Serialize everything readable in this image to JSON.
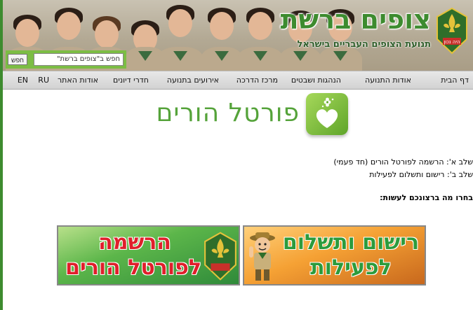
{
  "header": {
    "site_title": "צופים ברשת",
    "site_subtitle": "תנועת הצופים העבריים בישראל",
    "emblem_motto": "היה נכון"
  },
  "search": {
    "button_label": "חפש",
    "value": "חפש ב\"צופים ברשת\""
  },
  "nav": {
    "items": [
      {
        "label": "דף הבית"
      },
      {
        "label": "אודות התנועה"
      },
      {
        "label": "הנהגות ושבטים"
      },
      {
        "label": "מרכז הדרכה"
      },
      {
        "label": "אירועים בתנועה"
      },
      {
        "label": "חדרי דיונים"
      },
      {
        "label": "אודות האתר"
      },
      {
        "label": "RU"
      },
      {
        "label": "EN"
      }
    ]
  },
  "portal": {
    "title": "פורטל הורים"
  },
  "steps": {
    "step_a": "שלב א': הרשמה לפורטל הורים (חד פעמי)",
    "step_b": "שלב ב': רישום ותשלום לפעילות",
    "prompt": "בחרו מה ברצונכם לעשות:"
  },
  "banners": {
    "register": {
      "line1": "הרשמה",
      "line2": "לפורטל הורים"
    },
    "payment": {
      "line1": "רישום ותשלום",
      "line2": "לפעילות"
    }
  },
  "colors": {
    "brand_green": "#3d8b2f",
    "search_bar": "#7cbd44",
    "banner_red_text": "#e01f2b",
    "banner_green_text": "#2c9b3c"
  }
}
